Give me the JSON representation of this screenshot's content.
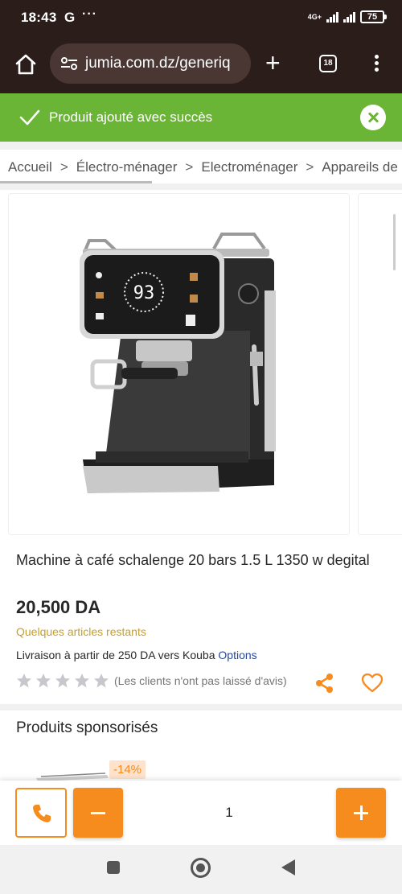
{
  "status": {
    "time": "18:43",
    "google": "G",
    "dots": "···",
    "network": "4G+",
    "battery": "75"
  },
  "browser": {
    "url": "jumia.com.dz/generiq",
    "tab_count": "18"
  },
  "banner": {
    "message": "Produit ajouté avec succès"
  },
  "breadcrumb": [
    "Accueil",
    "Électro-ménager",
    "Electroménager",
    "Appareils de"
  ],
  "product": {
    "title": "Machine à café schalenge 20 bars 1.5 L 1350 w degital",
    "price": "20,500 DA",
    "stock": "Quelques articles restants",
    "delivery_prefix": "Livraison à partir de ",
    "delivery_amount": "250 DA",
    "delivery_suffix": " vers Kouba ",
    "delivery_options": "Options",
    "rating_stars": 0,
    "reviews": "(Les clients n'ont pas laissé d'avis)",
    "display_temp": "93"
  },
  "sponsored": {
    "heading": "Produits sponsorisés",
    "discount": "-14%"
  },
  "cart": {
    "quantity": "1"
  },
  "colors": {
    "brand_orange": "#f68b1e",
    "success_green": "#6bb536",
    "header_dark": "#2b1d1a",
    "stock_gold": "#c6a02b",
    "link_blue": "#264996"
  }
}
